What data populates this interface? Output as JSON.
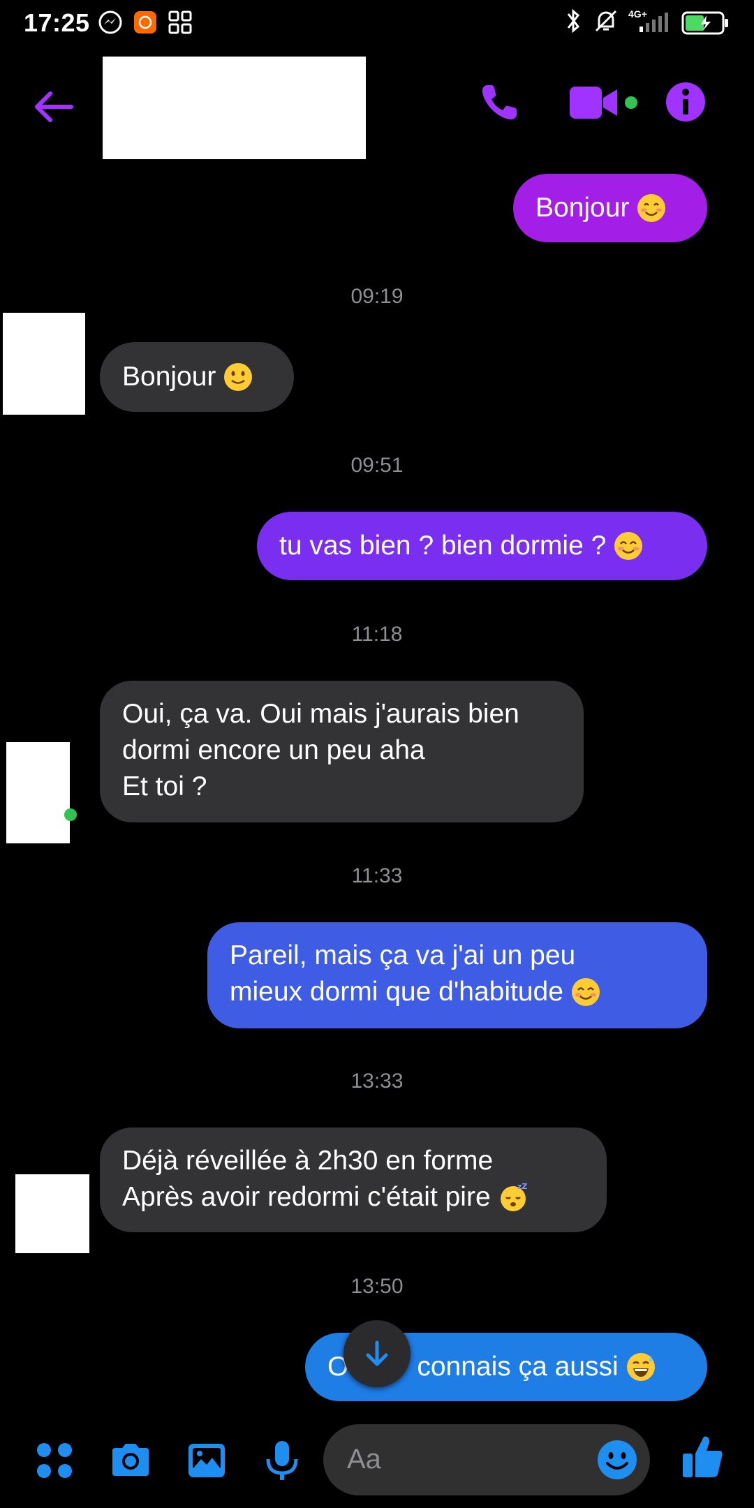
{
  "status_bar": {
    "time": "17:25",
    "network": "4G+"
  },
  "header": {
    "back_icon": "arrow-left-icon",
    "call_icon": "phone-icon",
    "video_icon": "video-camera-icon",
    "info_icon": "info-icon",
    "accent": "#a033ff"
  },
  "messages": [
    {
      "type": "out",
      "text": "Bonjour",
      "emoji": "smiling-blush-emoji"
    },
    {
      "type": "time",
      "text": "09:19"
    },
    {
      "type": "in",
      "text": "Bonjour",
      "emoji": "slight-smile-emoji"
    },
    {
      "type": "time",
      "text": "09:51"
    },
    {
      "type": "out",
      "text": "tu vas bien ? bien dormie ?",
      "emoji": "smiling-eyes-emoji"
    },
    {
      "type": "time",
      "text": "11:18"
    },
    {
      "type": "in",
      "lines": [
        "Oui, ça va. Oui mais j'aurais bien",
        "dormi encore un peu aha",
        "Et toi ?"
      ]
    },
    {
      "type": "time",
      "text": "11:33"
    },
    {
      "type": "out",
      "lines": [
        "Pareil, mais ça va j'ai un peu",
        "mieux dormi que d'habitude"
      ],
      "emoji": "smiling-eyes-emoji"
    },
    {
      "type": "time",
      "text": "13:33"
    },
    {
      "type": "in",
      "lines": [
        "Déjà réveillée à 2h30 en forme",
        "Après avoir redormi c'était pire"
      ],
      "emoji": "sleeping-emoji"
    },
    {
      "type": "time",
      "text": "13:50"
    },
    {
      "type": "out",
      "text_left": "O",
      "text_right": "connais ça aussi",
      "emoji": "grinning-sweat-emoji"
    }
  ],
  "bubble_colors": [
    "#a31fe8",
    "#7a2ff0",
    "#3e5de4",
    "#1f7de6"
  ],
  "composer": {
    "placeholder": "Aa",
    "icons": [
      "menu-dots-icon",
      "camera-icon",
      "image-icon",
      "microphone-icon",
      "emoji-icon",
      "thumbs-up-icon"
    ],
    "accent": "#1f8ef1"
  }
}
